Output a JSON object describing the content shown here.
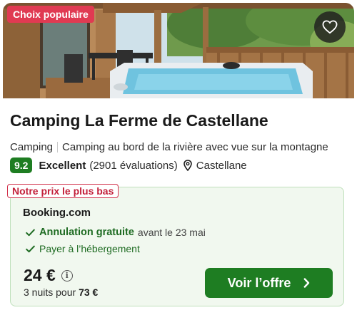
{
  "listing": {
    "badge": "Choix populaire",
    "title": "Camping La Ferme de Castellane",
    "type": "Camping",
    "description": "Camping au bord de la rivière avec vue sur la montagne",
    "score": "9.2",
    "rating_label": "Excellent",
    "reviews": "(2901 évaluations)",
    "location": "Castellane"
  },
  "offer": {
    "tag": "Notre prix le plus bas",
    "provider": "Booking.com",
    "cancellation_bold": "Annulation gratuite",
    "cancellation_rest": "avant le 23 mai",
    "payment": "Payer à l’hébergement",
    "price": "24 €",
    "nights_prefix": "3 nuits pour",
    "nights_total": "73 €",
    "cta_label": "Voir l’offre"
  },
  "icons": {
    "favorite": "heart-icon",
    "info": "info-icon",
    "location": "map-pin-icon",
    "check": "check-icon",
    "chevron": "chevron-right-icon"
  },
  "colors": {
    "brand_green": "#1e7d22",
    "popular_badge": "#e03a52",
    "offer_background": "#f1f8ef",
    "lowest_tag_border": "#d2304a"
  }
}
